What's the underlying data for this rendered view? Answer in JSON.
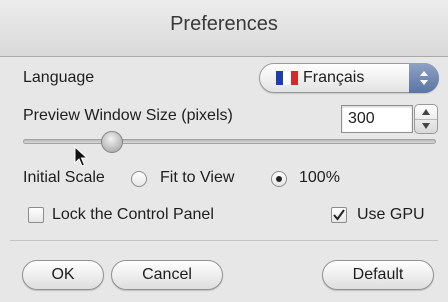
{
  "window": {
    "title": "Preferences"
  },
  "language": {
    "label": "Language",
    "value": "Français",
    "flag_colors": [
      "#1f3fa6",
      "#ffffff",
      "#d32a2a"
    ]
  },
  "preview": {
    "label": "Preview Window Size (pixels)",
    "value": "300",
    "slider_fraction": 0.2
  },
  "scale": {
    "label": "Initial Scale",
    "options": [
      {
        "label": "Fit to View",
        "selected": false
      },
      {
        "label": "100%",
        "selected": true
      }
    ]
  },
  "checkboxes": {
    "lock_panel": {
      "label": "Lock the Control Panel",
      "checked": false
    },
    "use_gpu": {
      "label": "Use GPU",
      "checked": true
    }
  },
  "buttons": {
    "ok": "OK",
    "cancel": "Cancel",
    "default": "Default"
  },
  "icons": [
    "up-down-arrows-icon",
    "stepper-up-icon",
    "stepper-down-icon",
    "checkmark-icon",
    "cursor-icon"
  ]
}
